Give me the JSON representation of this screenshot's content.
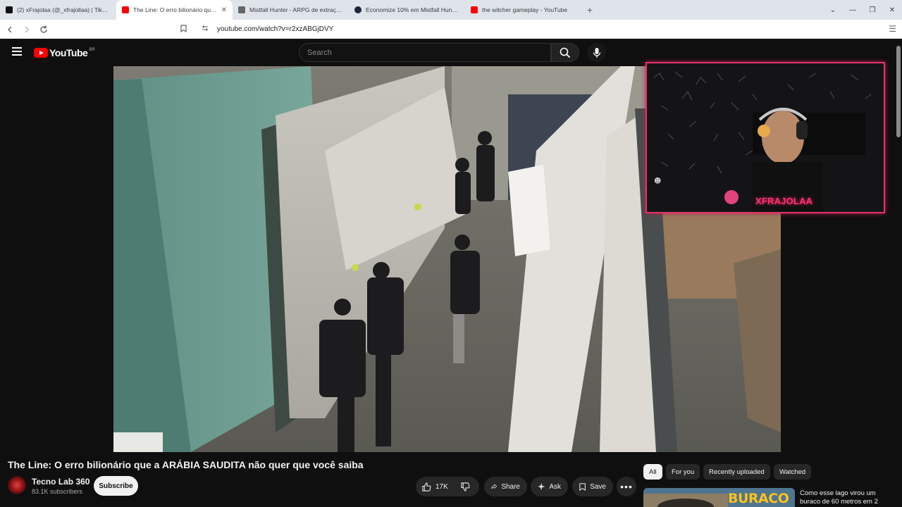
{
  "browser": {
    "tabs": [
      {
        "title": "(2) xFrajolaa (@_xfrajollaa) | TikTok",
        "favicon": "tiktok-icon",
        "color": "#111111",
        "active": false
      },
      {
        "title": "The Line: O erro bilionário que a ARÁBIA SAUDITA não quer que você saiba",
        "favicon": "youtube-icon",
        "color": "#ff0000",
        "active": true
      },
      {
        "title": "Mistfall Hunter - ARPG de extração de",
        "favicon": "mistfall-icon",
        "color": "#555555",
        "active": false
      },
      {
        "title": "Economize 10% em Mistfall Hunter no Steam",
        "favicon": "steam-icon",
        "color": "#1b2838",
        "active": false
      },
      {
        "title": "the witcher gameplay - YouTube",
        "favicon": "youtube-icon",
        "color": "#ff0000",
        "active": false
      }
    ],
    "close_glyph": "✕",
    "new_tab_glyph": "+",
    "url": "youtube.com/watch?v=r2xzABGjDVY"
  },
  "youtube": {
    "logo_text": "YouTube",
    "country_code": "BR",
    "search_placeholder": "Search",
    "video": {
      "title": "The Line: O erro bilionário que a ARÁBIA SAUDITA não quer que você saiba"
    },
    "channel": {
      "name": "Tecno Lab 360",
      "subscribers": "83.1K subscribers",
      "subscribe_label": "Subscribe"
    },
    "actions": {
      "likes": "17K",
      "share": "Share",
      "ask": "Ask",
      "save": "Save",
      "more": "•••"
    },
    "chips": [
      "All",
      "For you",
      "Recently uploaded",
      "Watched"
    ],
    "next_video": {
      "thumbnail_text": "BURACO",
      "title": "Como esse lago virou um buraco de 60 metros em 2"
    }
  },
  "overlay": {
    "streamer_name": "XFRAJOLAA",
    "accent_color": "#e8336a"
  }
}
